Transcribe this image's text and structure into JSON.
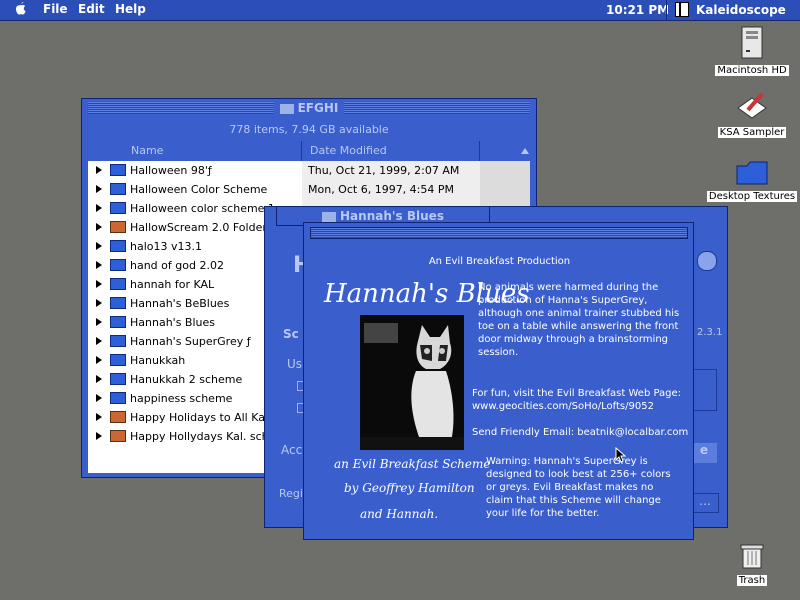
{
  "menubar": {
    "file": "File",
    "edit": "Edit",
    "help": "Help",
    "time": "10:21 PM",
    "app_name": "Kaleidoscope"
  },
  "desktop": {
    "hd": "Macintosh HD",
    "sampler": "KSA Sampler",
    "textures": "Desktop Textures",
    "trash": "Trash"
  },
  "efghi": {
    "title": "EFGHI",
    "info": "778 items, 7.94 GB available",
    "col_name": "Name",
    "col_date": "Date Modified",
    "rows": [
      {
        "name": "Halloween 98'ƒ",
        "date": "Thu, Oct 21, 1999, 2:07 AM"
      },
      {
        "name": "Halloween Color Scheme",
        "date": "Mon, Oct 6, 1997, 4:54 PM"
      },
      {
        "name": "Halloween color scheme.1",
        "date": ""
      },
      {
        "name": "HallowScream 2.0 Folder",
        "date": ""
      },
      {
        "name": "halo13 v13.1",
        "date": ""
      },
      {
        "name": "hand of god 2.02",
        "date": ""
      },
      {
        "name": "hannah for KAL",
        "date": ""
      },
      {
        "name": "Hannah's BeBlues",
        "date": ""
      },
      {
        "name": "Hannah's Blues",
        "date": ""
      },
      {
        "name": "Hannah's SuperGrey ƒ",
        "date": ""
      },
      {
        "name": "Hanukkah",
        "date": ""
      },
      {
        "name": "Hanukkah 2 scheme",
        "date": ""
      },
      {
        "name": "happiness scheme",
        "date": ""
      },
      {
        "name": "Happy Holidays to All Kal. Sc",
        "date": ""
      },
      {
        "name": "Happy Hollydays Kal. schem",
        "date": ""
      }
    ]
  },
  "hblues": {
    "title": "Hannah's Blues",
    "frag_h": "H",
    "frag_sc": "Sc",
    "frag_us": "Us",
    "frag_acc": "Acc",
    "frag_reg": "Regi",
    "frag_ver": "2.3.1",
    "frag_e": "e",
    "frag_dots": "..."
  },
  "about": {
    "production": "An Evil Breakfast Production",
    "title": "Hannah's Blues",
    "credit1": "an Evil Breakfast Scheme",
    "credit2": "by Geoffrey Hamilton",
    "credit3": "and Hannah.",
    "para1": "No animals were harmed during the production of Hanna's SuperGrey, although one animal trainer stubbed his toe on a table while answering the front door midway through a brainstorming session.",
    "fun": "For fun, visit the Evil Breakfast Web Page:",
    "url": "www.geocities.com/SoHo/Lofts/9052",
    "email": "Send Friendly Email: beatnik@localbar.com",
    "warning": "Warning: Hannah's SuperGrey is designed to look best at 256+ colors or greys. Evil Breakfast makes no claim that this Scheme will change your life for the better."
  }
}
